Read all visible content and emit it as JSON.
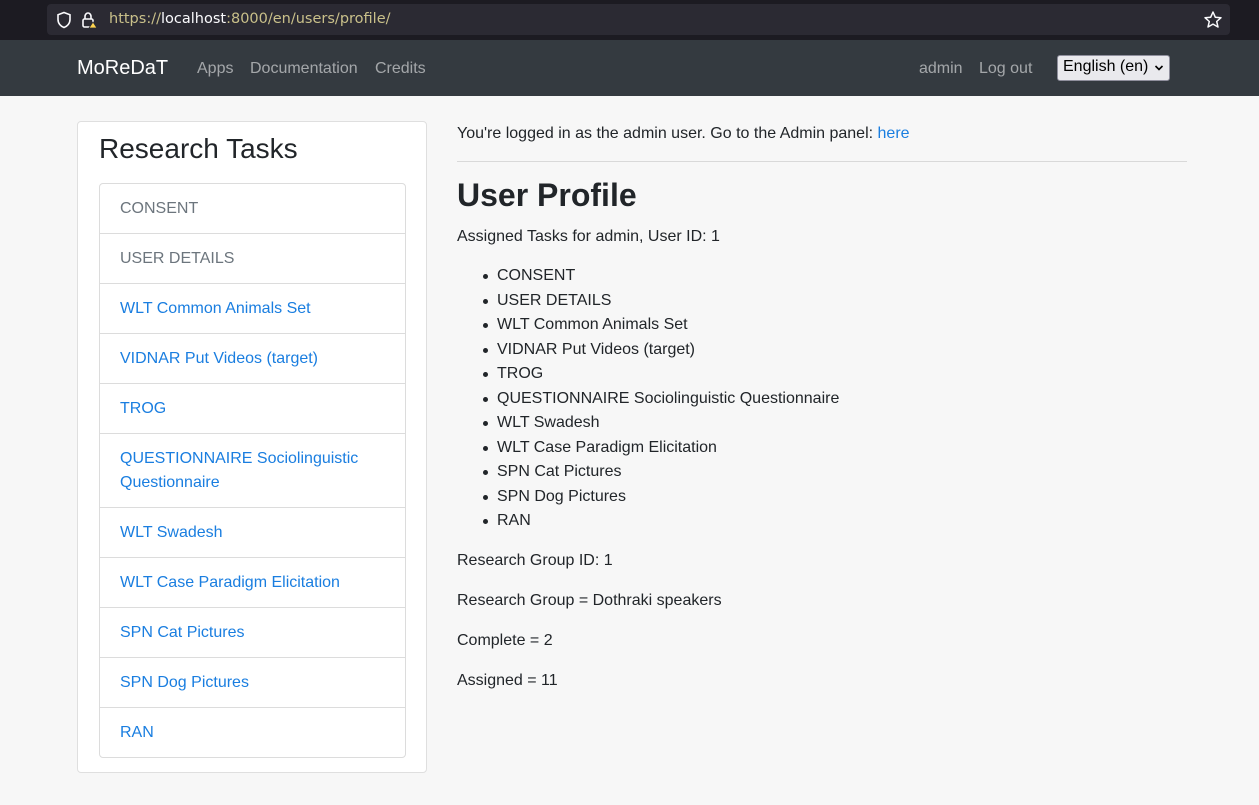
{
  "browser": {
    "url_protocol": "https://",
    "url_host": "localhost",
    "url_rest": ":8000/en/users/profile/"
  },
  "navbar": {
    "brand": "MoReDaT",
    "links": [
      "Apps",
      "Documentation",
      "Credits"
    ],
    "user": "admin",
    "logout": "Log out",
    "language": "English (en)"
  },
  "sidebar": {
    "title": "Research Tasks",
    "tasks": [
      {
        "label": "CONSENT",
        "status": "done"
      },
      {
        "label": "USER DETAILS",
        "status": "done"
      },
      {
        "label": "WLT Common Animals Set",
        "status": "todo"
      },
      {
        "label": "VIDNAR Put Videos (target)",
        "status": "todo"
      },
      {
        "label": "TROG",
        "status": "todo"
      },
      {
        "label": "QUESTIONNAIRE Sociolinguistic Questionnaire",
        "status": "todo"
      },
      {
        "label": "WLT Swadesh",
        "status": "todo"
      },
      {
        "label": "WLT Case Paradigm Elicitation",
        "status": "todo"
      },
      {
        "label": "SPN Cat Pictures",
        "status": "todo"
      },
      {
        "label": "SPN Dog Pictures",
        "status": "todo"
      },
      {
        "label": "RAN",
        "status": "todo"
      }
    ]
  },
  "main": {
    "login_note": "You're logged in as the admin user. Go to the Admin panel: ",
    "admin_link": "here",
    "title": "User Profile",
    "assigned_heading": "Assigned Tasks for admin, User ID: 1",
    "assigned_tasks": [
      "CONSENT",
      "USER DETAILS",
      "WLT Common Animals Set",
      "VIDNAR Put Videos (target)",
      "TROG",
      "QUESTIONNAIRE Sociolinguistic Questionnaire",
      "WLT Swadesh",
      "WLT Case Paradigm Elicitation",
      "SPN Cat Pictures",
      "SPN Dog Pictures",
      "RAN"
    ],
    "research_group_id": "Research Group ID: 1",
    "research_group": "Research Group = Dothraki speakers",
    "complete": "Complete = 2",
    "assigned": "Assigned = 11"
  },
  "colors": {
    "navbar_bg": "#343a40",
    "link": "#1a7ee0",
    "muted": "#6c757d",
    "page_bg": "#f7f7f7"
  },
  "icons": [
    "shield-icon",
    "lock-icon",
    "bookmark-star-icon",
    "chevron-down-icon"
  ]
}
